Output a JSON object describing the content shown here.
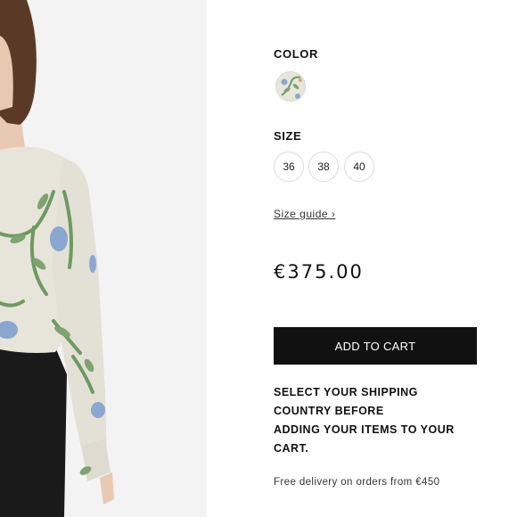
{
  "product": {
    "color_label": "COLOR",
    "color_swatch_icon": "floral-pattern-swatch",
    "size_label": "SIZE",
    "sizes": [
      "36",
      "38",
      "40"
    ],
    "size_guide_label": "Size guide ›",
    "price": "€375.00",
    "add_to_cart_label": "ADD TO CART",
    "shipping_notice_lines": [
      "SELECT YOUR SHIPPING",
      "COUNTRY BEFORE",
      "ADDING YOUR ITEMS TO YOUR",
      "CART."
    ],
    "free_delivery_text": "Free delivery on orders from €450"
  },
  "colors": {
    "button_background": "#111111",
    "button_text": "#ffffff",
    "text_primary": "#111111",
    "border_light": "#d9d9d9"
  }
}
